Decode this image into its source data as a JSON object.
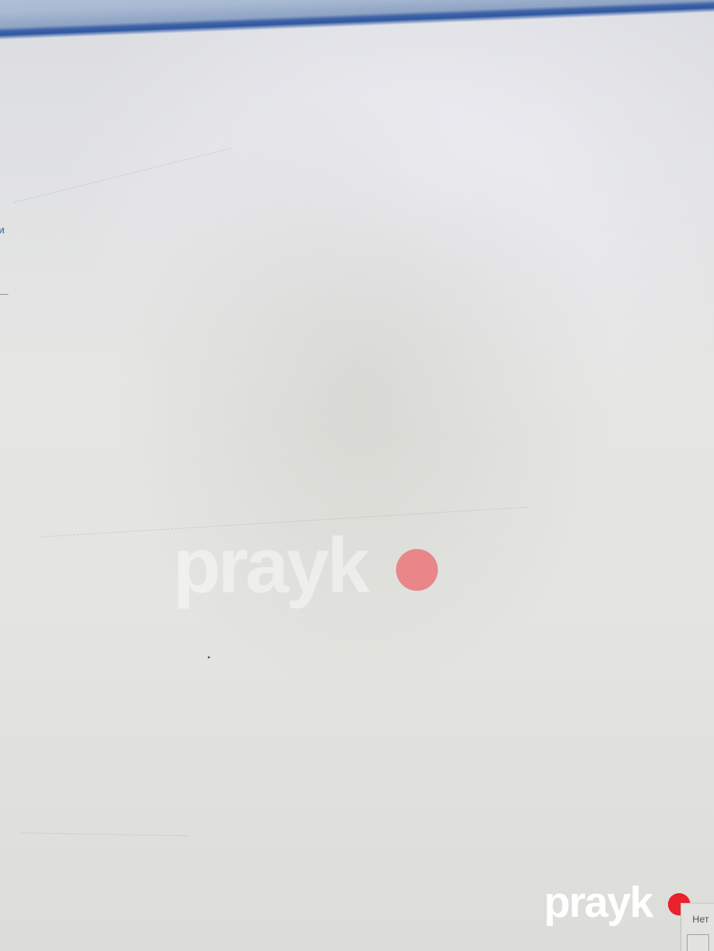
{
  "sidebar": {
    "link_fragment": "и"
  },
  "watermark": {
    "text": "prayk"
  },
  "bottom_panel": {
    "label": "Нет"
  },
  "colors": {
    "titlebar_accent": "#2f56a0",
    "link": "#2a5d9e",
    "watermark_dot": "#e8232d"
  }
}
